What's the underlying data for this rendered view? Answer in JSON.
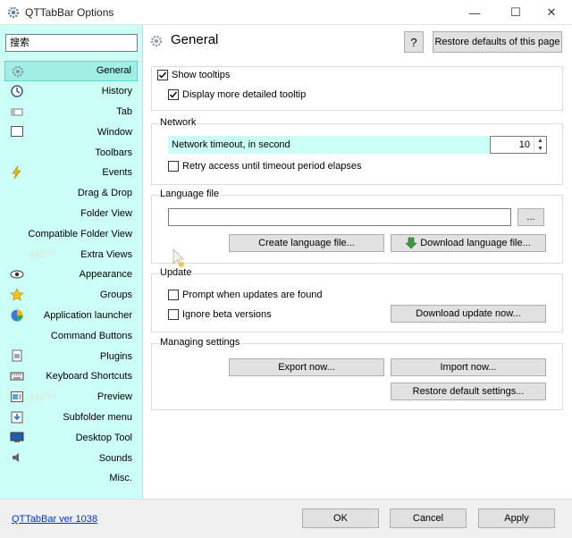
{
  "window": {
    "title": "QTTabBar Options",
    "controls": {
      "minimize": "—",
      "maximize": "☐",
      "close": "✕"
    }
  },
  "sidebar": {
    "search_value": "搜索",
    "items": [
      {
        "label": "General",
        "icon": "gear-icon",
        "selected": true
      },
      {
        "label": "History",
        "icon": "history-icon"
      },
      {
        "label": "Tab",
        "icon": "tab-icon"
      },
      {
        "label": "Window",
        "icon": "window-icon"
      },
      {
        "label": "Toolbars",
        "icon": ""
      },
      {
        "label": "Events",
        "icon": "lightning-icon"
      },
      {
        "label": "Drag & Drop",
        "icon": ""
      },
      {
        "label": "Folder View",
        "icon": ""
      },
      {
        "label": "Compatible Folder View",
        "icon": ""
      },
      {
        "label": "Extra Views",
        "icon": "",
        "badge": "New"
      },
      {
        "label": "Appearance",
        "icon": "eye-icon"
      },
      {
        "label": "Groups",
        "icon": "star-icon"
      },
      {
        "label": "Application launcher",
        "icon": "launcher-icon"
      },
      {
        "label": "Command Buttons",
        "icon": ""
      },
      {
        "label": "Plugins",
        "icon": "plugin-icon"
      },
      {
        "label": "Keyboard Shortcuts",
        "icon": "keyboard-icon"
      },
      {
        "label": "Preview",
        "icon": "preview-icon",
        "badge": "New"
      },
      {
        "label": "Subfolder menu",
        "icon": "subfolder-icon"
      },
      {
        "label": "Desktop Tool",
        "icon": "desktop-icon"
      },
      {
        "label": "Sounds",
        "icon": "speaker-icon"
      },
      {
        "label": "Misc.",
        "icon": ""
      }
    ]
  },
  "main": {
    "title": "General",
    "help_label": "?",
    "restore_page_label": "Restore defaults of this page",
    "tooltips": {
      "show_tooltips": {
        "label": "Show tooltips",
        "checked": true
      },
      "detailed_tooltip": {
        "label": "Display more detailed tooltip",
        "checked": true
      }
    },
    "network": {
      "group_label": "Network",
      "timeout_label": "Network timeout, in second",
      "timeout_value": "10",
      "retry": {
        "label": "Retry access until timeout period elapses",
        "checked": false
      }
    },
    "language": {
      "group_label": "Language file",
      "path_value": "",
      "browse_label": "...",
      "create_label": "Create language file...",
      "download_label": "Download language file..."
    },
    "update": {
      "group_label": "Update",
      "prompt": {
        "label": "Prompt when updates are found",
        "checked": false
      },
      "ignore_beta": {
        "label": "Ignore beta versions",
        "checked": false
      },
      "download_label": "Download update now..."
    },
    "managing": {
      "group_label": "Managing settings",
      "export_label": "Export now...",
      "import_label": "Import now...",
      "restore_label": "Restore default settings..."
    }
  },
  "footer": {
    "version_link": "QTTabBar ver 1038",
    "ok_label": "OK",
    "cancel_label": "Cancel",
    "apply_label": "Apply"
  },
  "colors": {
    "sidebar_bg": "#ccfff6",
    "selected_bg": "#a1efe4",
    "link": "#0033cc"
  }
}
